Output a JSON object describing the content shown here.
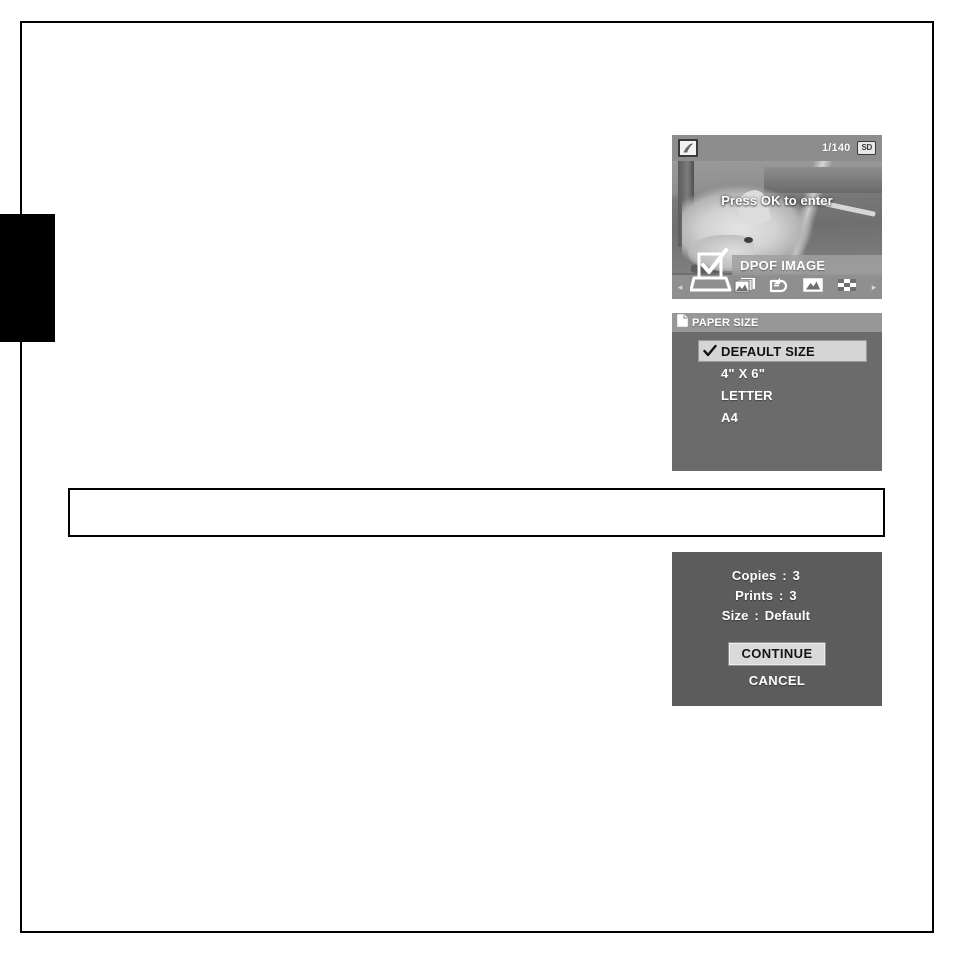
{
  "page": {
    "note_box_text": ""
  },
  "lcd": {
    "mode_icon": "playback-mode-icon",
    "frame_counter": "1/140",
    "storage_badge": "SD",
    "hint_text": "Press OK to enter",
    "menu_label": "DPOF IMAGE",
    "prev_arrow": "◂",
    "next_arrow": "▸",
    "icons": [
      {
        "name": "dpof-print-icon",
        "label": "DPOF print"
      },
      {
        "name": "multi-image-icon",
        "label": "Multi image"
      },
      {
        "name": "rotate-image-icon",
        "label": "Rotate image"
      },
      {
        "name": "single-image-icon",
        "label": "Single image"
      },
      {
        "name": "index-thumbnails-icon",
        "label": "Index thumbnails"
      }
    ]
  },
  "paper_size": {
    "title_icon": "page-document-icon",
    "title": "PAPER SIZE",
    "options": [
      {
        "label": "DEFAULT SIZE",
        "selected": true
      },
      {
        "label": "4\" X 6\"",
        "selected": false
      },
      {
        "label": "LETTER",
        "selected": false
      },
      {
        "label": "A4",
        "selected": false
      }
    ]
  },
  "confirm": {
    "rows": [
      {
        "label": "Copies",
        "sep": ":",
        "value": "3"
      },
      {
        "label": "Prints",
        "sep": ":",
        "value": "3"
      },
      {
        "label": "Size",
        "sep": ":",
        "value": "Default"
      }
    ],
    "continue_label": "CONTINUE",
    "cancel_label": "CANCEL"
  },
  "colors": {
    "lcd_background": "#6e6e6e",
    "lcd_statusbar": "#8d8d8d",
    "paper_panel": "#6b6b6b",
    "paper_titlebar": "#979797",
    "paper_selected_row": "#d5d5d5",
    "confirm_panel": "#5c5c5c",
    "continue_button": "#d9d9d9",
    "page_border": "#000000",
    "section_tab": "#000000"
  }
}
